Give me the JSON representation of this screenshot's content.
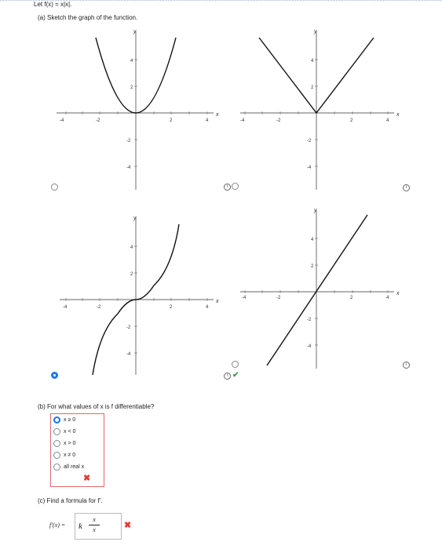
{
  "header": {
    "problem": "Let f(x) = x|x|."
  },
  "part_a": {
    "prompt": "(a)   Sketch the graph of the function.",
    "graphs": [
      {
        "id": "parabola",
        "axis_x": "x",
        "axis_y": "y",
        "x_ticks": [
          "-4",
          "-2",
          "2",
          "4"
        ],
        "y_ticks": [
          "4",
          "2",
          "-2",
          "-4"
        ],
        "state": "unselected"
      },
      {
        "id": "abs-value",
        "axis_x": "x",
        "axis_y": "y",
        "x_ticks": [
          "-4",
          "-2",
          "2",
          "4"
        ],
        "y_ticks": [
          "4",
          "2",
          "-2",
          "-4"
        ],
        "state": "unselected"
      },
      {
        "id": "x-abs-x",
        "axis_x": "x",
        "axis_y": "y",
        "x_ticks": [
          "-4",
          "-2",
          "2",
          "4"
        ],
        "y_ticks": [
          "4",
          "2",
          "-2",
          "-4"
        ],
        "state": "selected"
      },
      {
        "id": "line",
        "axis_x": "x",
        "axis_y": "y",
        "x_ticks": [
          "-4",
          "-2",
          "2",
          "4"
        ],
        "y_ticks": [
          "4",
          "2",
          "-2",
          "-4"
        ],
        "state": "unselected"
      }
    ],
    "info_icon": "info-icon",
    "result_icon": "check-icon"
  },
  "part_b": {
    "prompt": "(b)   For what values of x is f differentiable?",
    "options": [
      "x ≥ 0",
      "x < 0",
      "x > 0",
      "x ≠ 0",
      "all real x"
    ],
    "selected_index": 0,
    "result_icon": "cross-icon"
  },
  "part_c": {
    "prompt": "(c)   Find a formula for f′.",
    "lhs": "f′(x) =",
    "answer_k": "k",
    "answer_num": "x",
    "answer_den": "x",
    "result_icon": "cross-icon"
  },
  "colors": {
    "selected": "#1a73e8",
    "correct": "#43a047",
    "incorrect": "#e53935",
    "border_wrong": "#e06a6a"
  }
}
